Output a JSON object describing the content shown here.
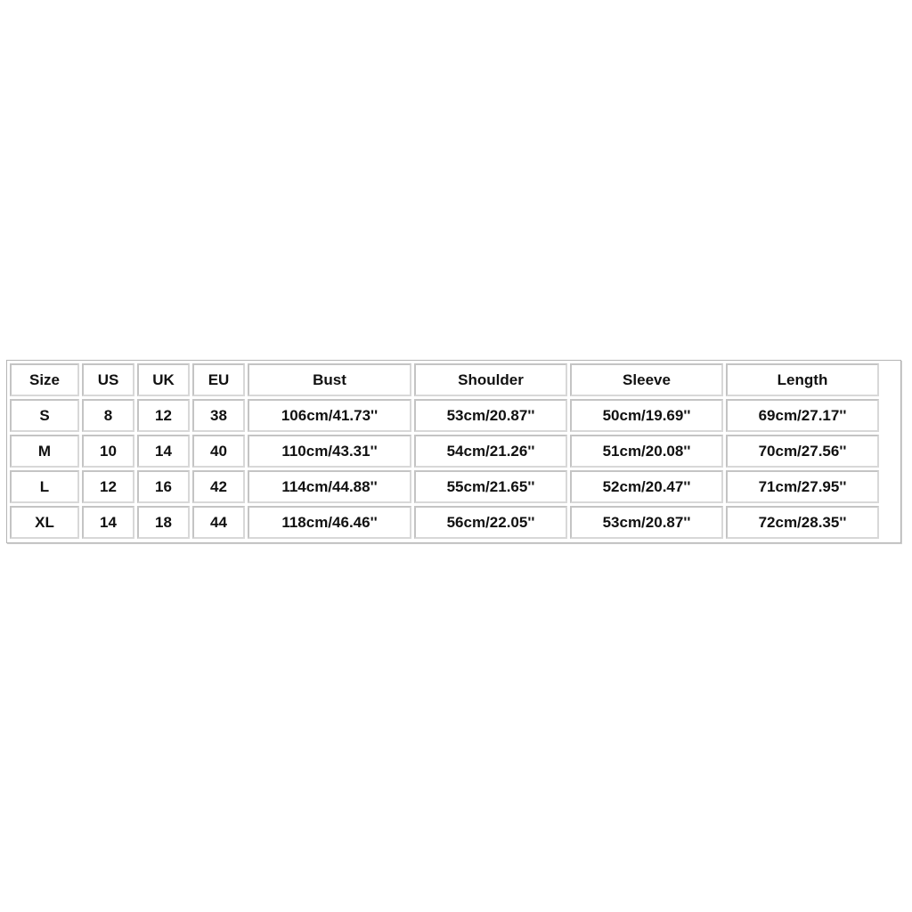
{
  "size_chart": {
    "headers": [
      "Size",
      "US",
      "UK",
      "EU",
      "Bust",
      "Shoulder",
      "Sleeve",
      "Length"
    ],
    "rows": [
      [
        "S",
        "8",
        "12",
        "38",
        "106cm/41.73''",
        "53cm/20.87''",
        "50cm/19.69''",
        "69cm/27.17''"
      ],
      [
        "M",
        "10",
        "14",
        "40",
        "110cm/43.31''",
        "54cm/21.26''",
        "51cm/20.08''",
        "70cm/27.56''"
      ],
      [
        "L",
        "12",
        "16",
        "42",
        "114cm/44.88''",
        "55cm/21.65''",
        "52cm/20.47''",
        "71cm/27.95''"
      ],
      [
        "XL",
        "14",
        "18",
        "44",
        "118cm/46.46''",
        "56cm/22.05''",
        "53cm/20.87''",
        "72cm/28.35''"
      ]
    ]
  },
  "colors": {
    "text": "#111111",
    "cell_border": "#c4c4c4",
    "background": "#ffffff"
  }
}
